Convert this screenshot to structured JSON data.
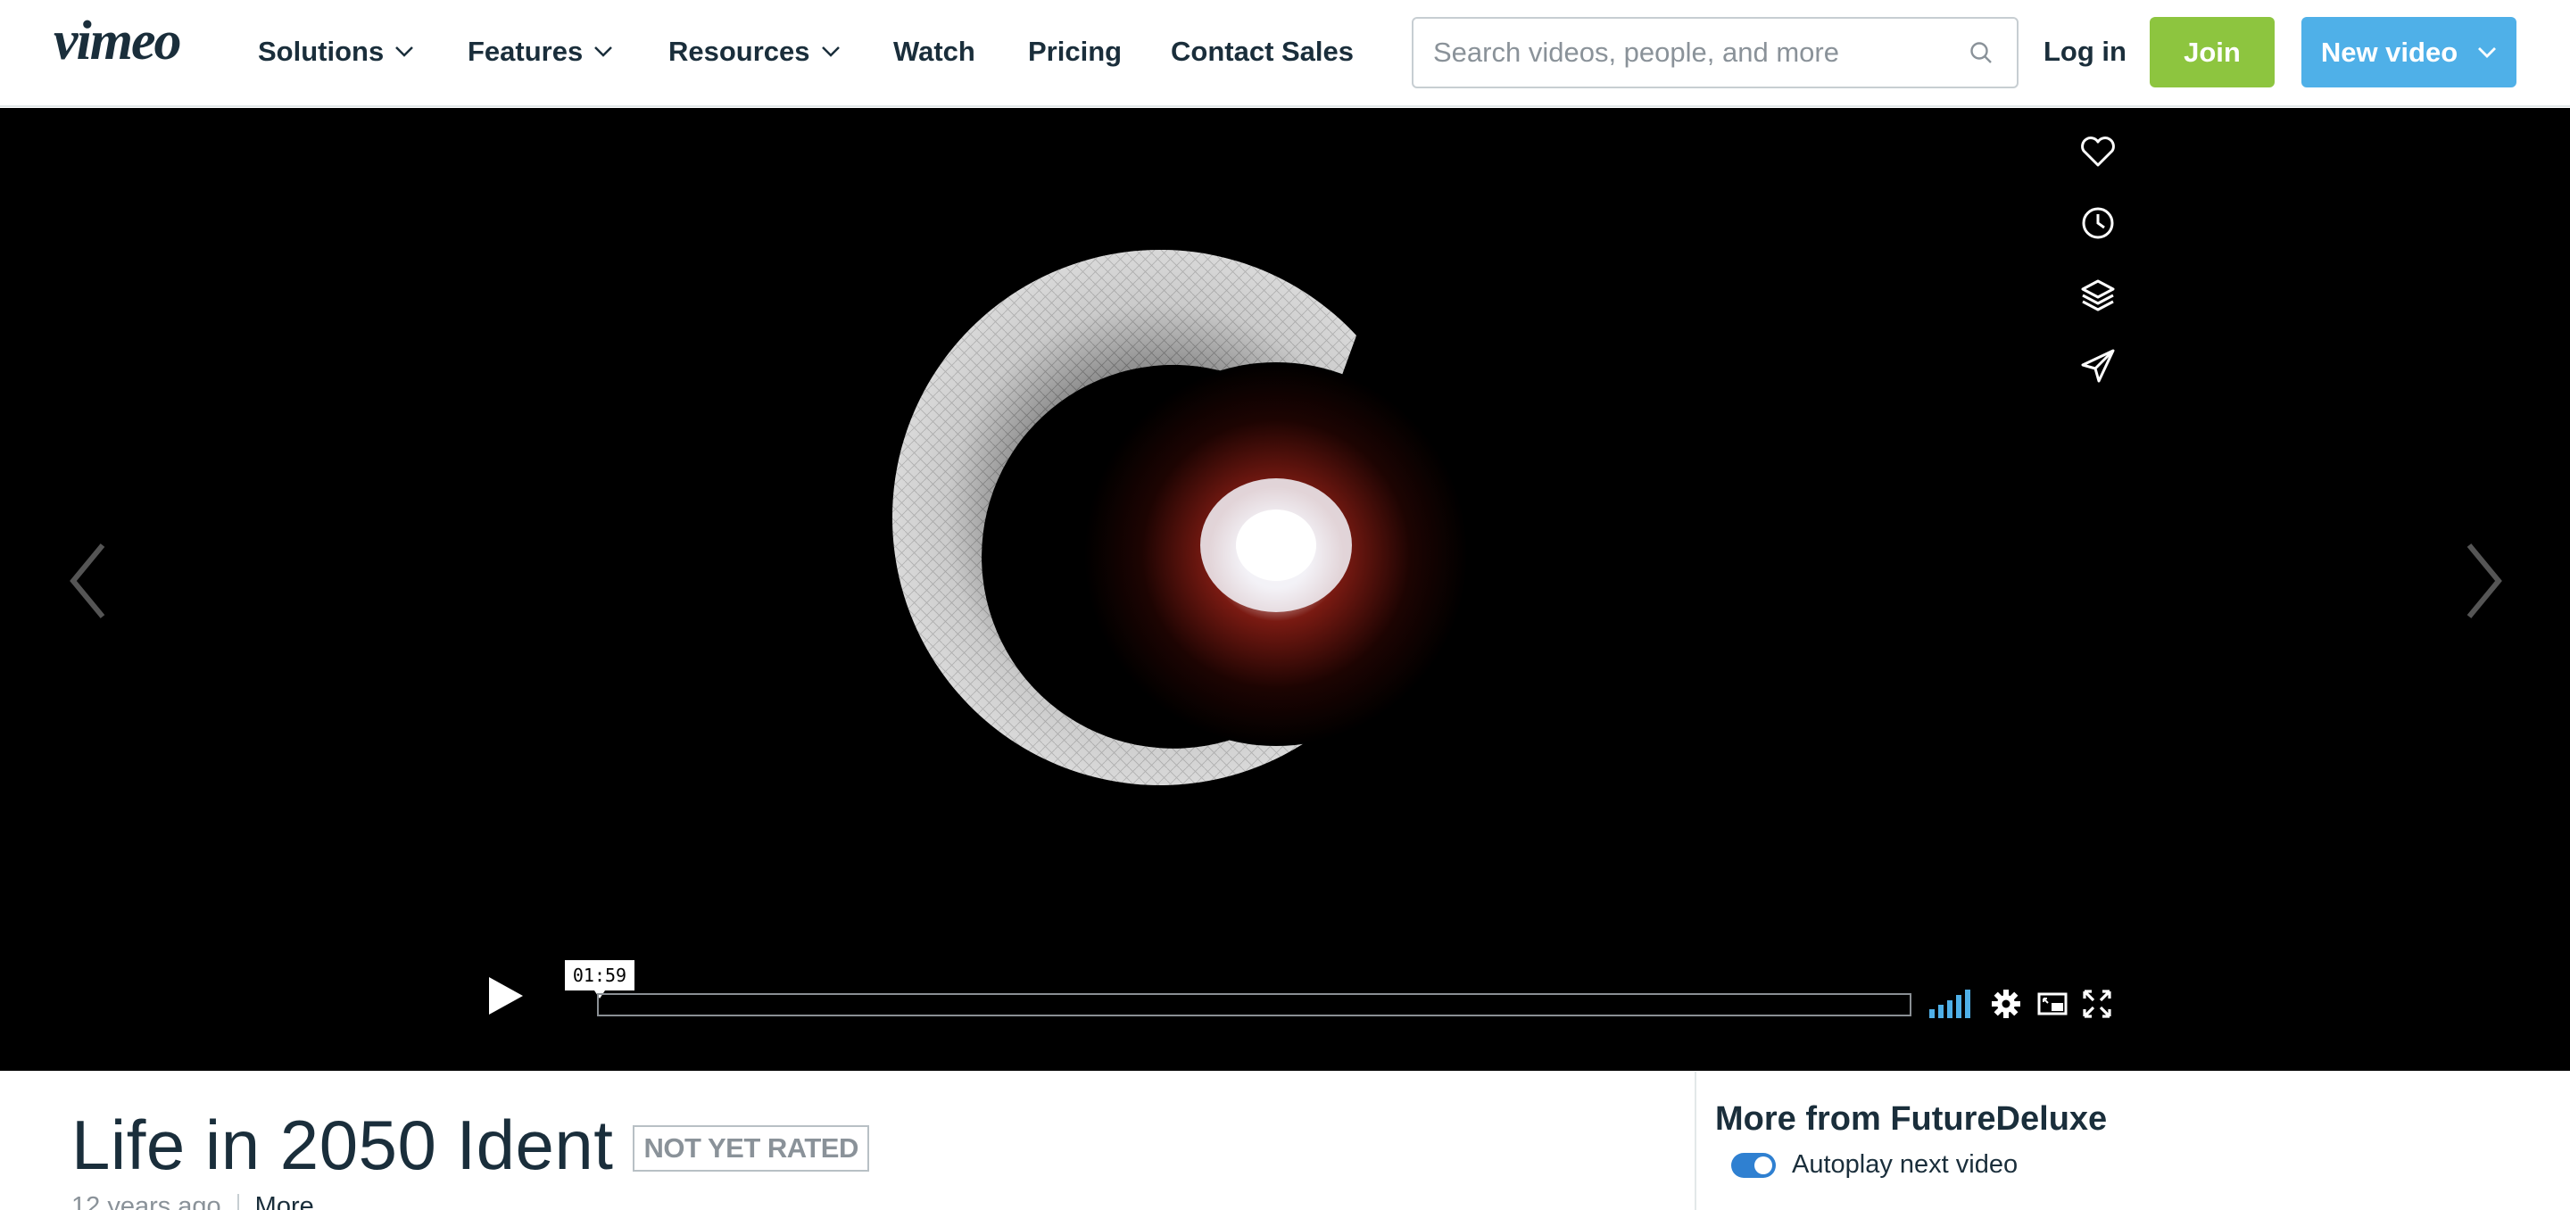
{
  "header": {
    "logo_text": "vimeo",
    "nav": [
      {
        "label": "Solutions",
        "has_dropdown": true
      },
      {
        "label": "Features",
        "has_dropdown": true
      },
      {
        "label": "Resources",
        "has_dropdown": true
      },
      {
        "label": "Watch",
        "has_dropdown": false
      },
      {
        "label": "Pricing",
        "has_dropdown": false
      },
      {
        "label": "Contact Sales",
        "has_dropdown": false
      }
    ],
    "search": {
      "placeholder": "Search videos, people, and more",
      "value": ""
    },
    "login_label": "Log in",
    "join_label": "Join",
    "new_video_label": "New video"
  },
  "player": {
    "current_time": "01:59",
    "progress": 0.0,
    "volume_level": 1.0,
    "side_actions": [
      "heart-icon",
      "clock-icon",
      "layers-icon",
      "send-icon"
    ],
    "controls_icons": [
      "play-icon",
      "settings-icon",
      "picture-in-picture-icon",
      "fullscreen-icon"
    ]
  },
  "video": {
    "title": "Life in 2050 Ident",
    "rating": "NOT YET RATED",
    "age": "12 years ago",
    "more_label": "More"
  },
  "sidebar": {
    "heading": "More from FutureDeluxe",
    "autoplay_label": "Autoplay next video",
    "autoplay_on": true
  },
  "colors": {
    "join": "#8dc53f",
    "new_video": "#4fb0e8",
    "volume": "#4fb0e8",
    "toggle": "#2f80d1",
    "text_dark": "#1a2e3b"
  }
}
